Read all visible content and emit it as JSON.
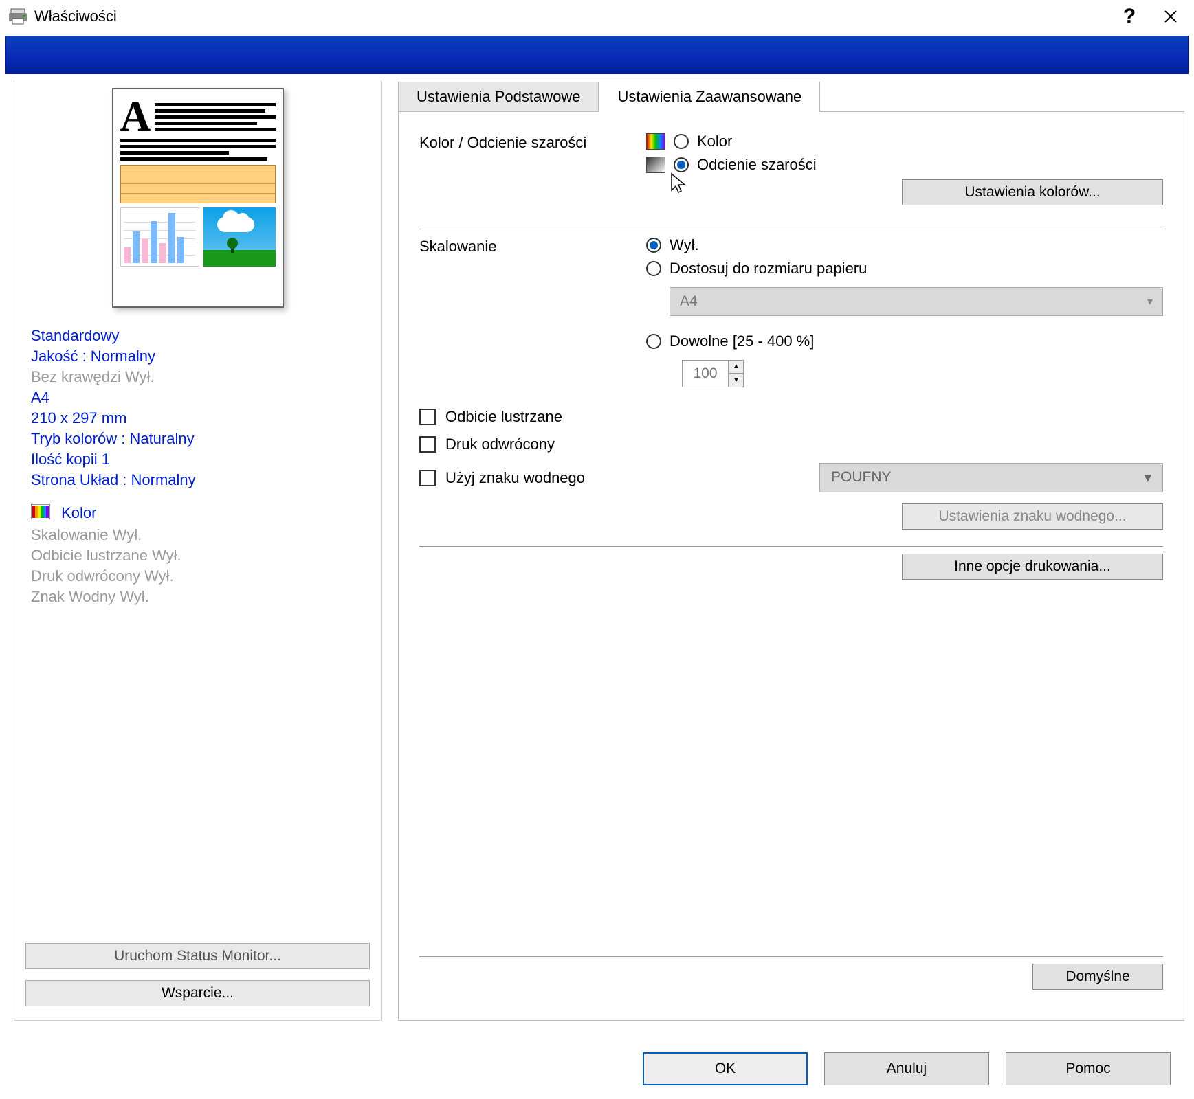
{
  "titlebar": {
    "title": "Właściwości"
  },
  "left": {
    "info": {
      "line1": "Standardowy",
      "line2": "Jakość : Normalny",
      "line3": "Bez krawędzi Wył.",
      "line4": "A4",
      "line5": "210 x 297 mm",
      "line6": "Tryb kolorów : Naturalny",
      "line7": "Ilość kopii 1",
      "line8": "Strona Układ : Normalny",
      "line9": "Kolor",
      "line10": "Skalowanie Wył.",
      "line11": "Odbicie lustrzane Wył.",
      "line12": "Druk odwrócony Wył.",
      "line13": "Znak Wodny Wył."
    },
    "buttons": {
      "status_monitor": "Uruchom Status Monitor...",
      "support": "Wsparcie..."
    }
  },
  "tabs": {
    "basic": "Ustawienia Podstawowe",
    "advanced": "Ustawienia Zaawansowane"
  },
  "adv": {
    "color_label": "Kolor / Odcienie szarości",
    "color_option": "Kolor",
    "gray_option": "Odcienie szarości",
    "color_settings_btn": "Ustawienia kolorów...",
    "scaling_label": "Skalowanie",
    "scaling_off": "Wył.",
    "scaling_fit": "Dostosuj do rozmiaru papieru",
    "scaling_fit_value": "A4",
    "scaling_custom": "Dowolne [25 - 400 %]",
    "scaling_custom_value": "100",
    "mirror": "Odbicie lustrzane",
    "reverse": "Druk odwrócony",
    "watermark": "Użyj znaku wodnego",
    "watermark_value": "POUFNY",
    "watermark_settings_btn": "Ustawienia znaku wodnego...",
    "other_opts_btn": "Inne opcje drukowania...",
    "defaults_btn": "Domyślne"
  },
  "footer": {
    "ok": "OK",
    "cancel": "Anuluj",
    "help": "Pomoc"
  }
}
